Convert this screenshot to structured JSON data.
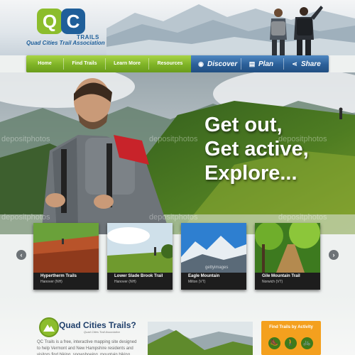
{
  "header": {
    "logo": {
      "mark_q": "Q",
      "mark_c": "C",
      "mark_word": "TRAILS",
      "tagline": "Quad Cities Trail Association"
    }
  },
  "nav": {
    "items": [
      {
        "label": "Home"
      },
      {
        "label": "Find Trails"
      },
      {
        "label": "Learn More"
      },
      {
        "label": "Resources"
      }
    ],
    "actions": [
      {
        "label": "Discover",
        "icon": "compass-icon"
      },
      {
        "label": "Plan",
        "icon": "map-icon"
      },
      {
        "label": "Share",
        "icon": "share-icon"
      }
    ]
  },
  "hero": {
    "headline_lines": [
      "Get out,",
      "Get active,",
      "Explore..."
    ],
    "watermark": "depositphotos"
  },
  "carousel": {
    "prev_icon": "chevron-left-icon",
    "next_icon": "chevron-right-icon",
    "cards": [
      {
        "title": "Hypertherm Trails",
        "location": "Hanover (NH)"
      },
      {
        "title": "Lower Slade Brook Trail",
        "location": "Hanover (NH)"
      },
      {
        "title": "Eagle Mountain",
        "location": "Milton (VT)"
      },
      {
        "title": "Gile Mountain Trail",
        "location": "Norwich (VT)"
      }
    ],
    "image_watermark": "gettyimages"
  },
  "about": {
    "title": "Quad Cities Trails?",
    "subtitle": "Quad Cities Trail Association",
    "body": "QC Trails is a free, interactive mapping site designed to help Vermont and New Hampshire residents and visitors find hiking, snowshoeing, mountain biking, cross country"
  },
  "find_trails": {
    "title": "Find Trails by Activity",
    "activities": [
      "hiking-icon",
      "walking-icon",
      "biking-icon"
    ]
  },
  "colors": {
    "nav_green": "#7fb326",
    "nav_blue": "#2b5f98",
    "brand_blue": "#1f5f9a",
    "brand_green": "#8cbd2c",
    "find_orange": "#f4a01e"
  }
}
